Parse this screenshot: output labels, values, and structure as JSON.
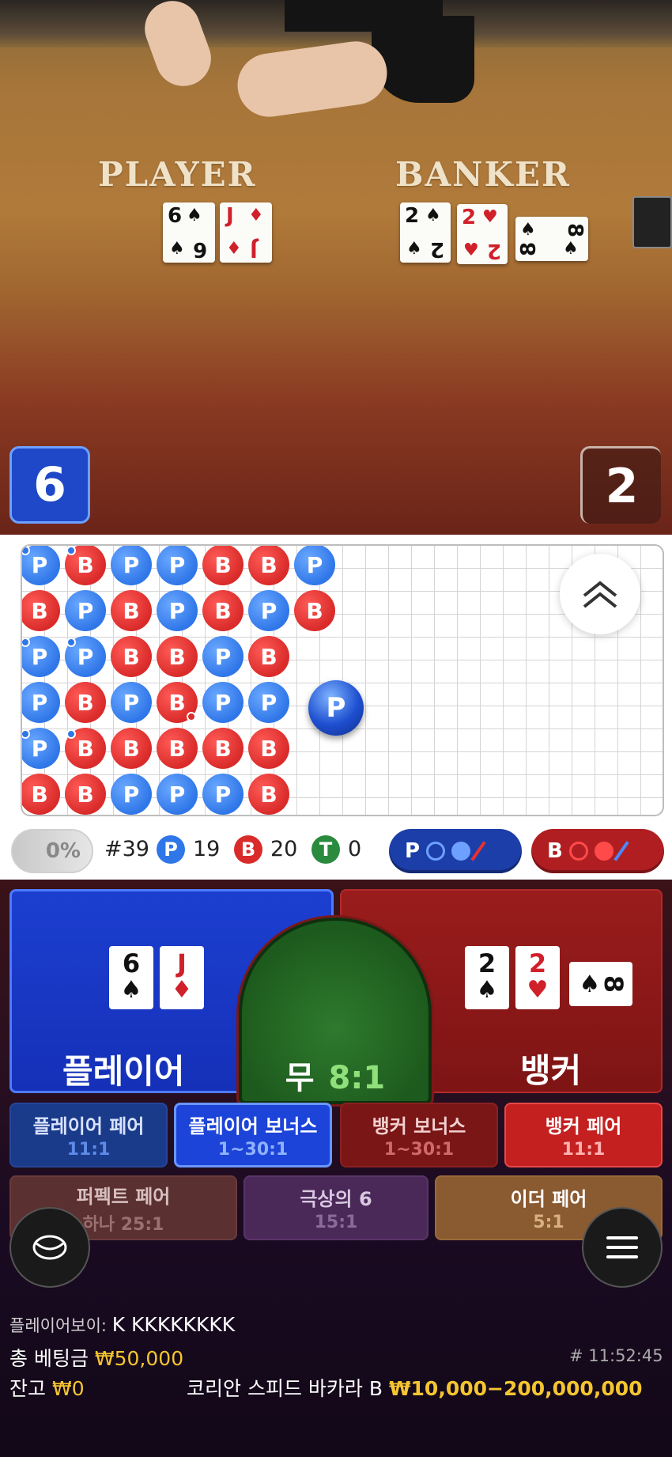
{
  "video": {
    "player_label": "PLAYER",
    "banker_label": "BANKER",
    "player_cards": [
      {
        "rank": "6",
        "suit": "♠",
        "color": "black"
      },
      {
        "rank": "J",
        "suit": "♦",
        "color": "red"
      }
    ],
    "banker_cards": [
      {
        "rank": "2",
        "suit": "♠",
        "color": "black"
      },
      {
        "rank": "2",
        "suit": "♥",
        "color": "red"
      },
      {
        "rank": "8",
        "suit": "♠",
        "color": "black"
      }
    ],
    "player_score": "6",
    "banker_score": "2"
  },
  "roadmap": {
    "columns": [
      [
        "P",
        "B",
        "P",
        "P",
        "P",
        "B"
      ],
      [
        "B",
        "P",
        "P",
        "B",
        "B",
        "B"
      ],
      [
        "P",
        "B",
        "B",
        "P",
        "B",
        "P"
      ],
      [
        "P",
        "P",
        "B",
        "B",
        "B",
        "P"
      ],
      [
        "B",
        "B",
        "P",
        "P",
        "B",
        "P"
      ],
      [
        "B",
        "P",
        "B",
        "P",
        "B",
        "B"
      ],
      [
        "P",
        "B",
        "",
        "",
        "",
        ""
      ]
    ],
    "next_bead": "P",
    "expand_icon": "double-chevron-up-icon"
  },
  "stats": {
    "percent": "0%",
    "round": "#39",
    "player_letter": "P",
    "player_count": "19",
    "banker_letter": "B",
    "banker_count": "20",
    "tie_letter": "T",
    "tie_count": "0",
    "player_predict": "P",
    "banker_predict": "B"
  },
  "bets": {
    "player_label": "플레이어",
    "banker_label": "뱅커",
    "tie_label": "무",
    "tie_odds": "8:1",
    "player_cards": [
      {
        "rank": "6",
        "suit": "♠",
        "color": "black"
      },
      {
        "rank": "J",
        "suit": "♦",
        "color": "red"
      }
    ],
    "banker_cards": [
      {
        "rank": "2",
        "suit": "♠",
        "color": "black"
      },
      {
        "rank": "2",
        "suit": "♥",
        "color": "red"
      },
      {
        "rank": "8",
        "suit": "♠",
        "color": "black"
      }
    ],
    "side": [
      {
        "title": "플레이어 페어",
        "odds": "11:1"
      },
      {
        "title": "플레이어 보너스",
        "odds": "1~30:1"
      },
      {
        "title": "뱅커 보너스",
        "odds": "1~30:1"
      },
      {
        "title": "뱅커 페어",
        "odds": "11:1"
      },
      {
        "title": "퍼펙트 페어",
        "odds": "하나 25:1"
      },
      {
        "title": "극상의 6",
        "odds": "15:1"
      },
      {
        "title": "이더 페어",
        "odds": "5:1"
      }
    ]
  },
  "footer": {
    "player_label": "플레이어보이:",
    "player_name": "K KKKKKKKK",
    "total_bet_label": "총 베팅금",
    "total_bet_value": "₩50,000",
    "time": "# 11:52:45",
    "balance_label": "잔고",
    "balance_value": "₩0",
    "table_name": "코리안 스피드 바카라 B",
    "limits": "₩10,000−200,000,000"
  },
  "colors": {
    "player_blue": "#1c3fd0",
    "banker_red": "#9a1c1c",
    "tie_green": "#2e7a2e",
    "gold": "#f5c530"
  }
}
